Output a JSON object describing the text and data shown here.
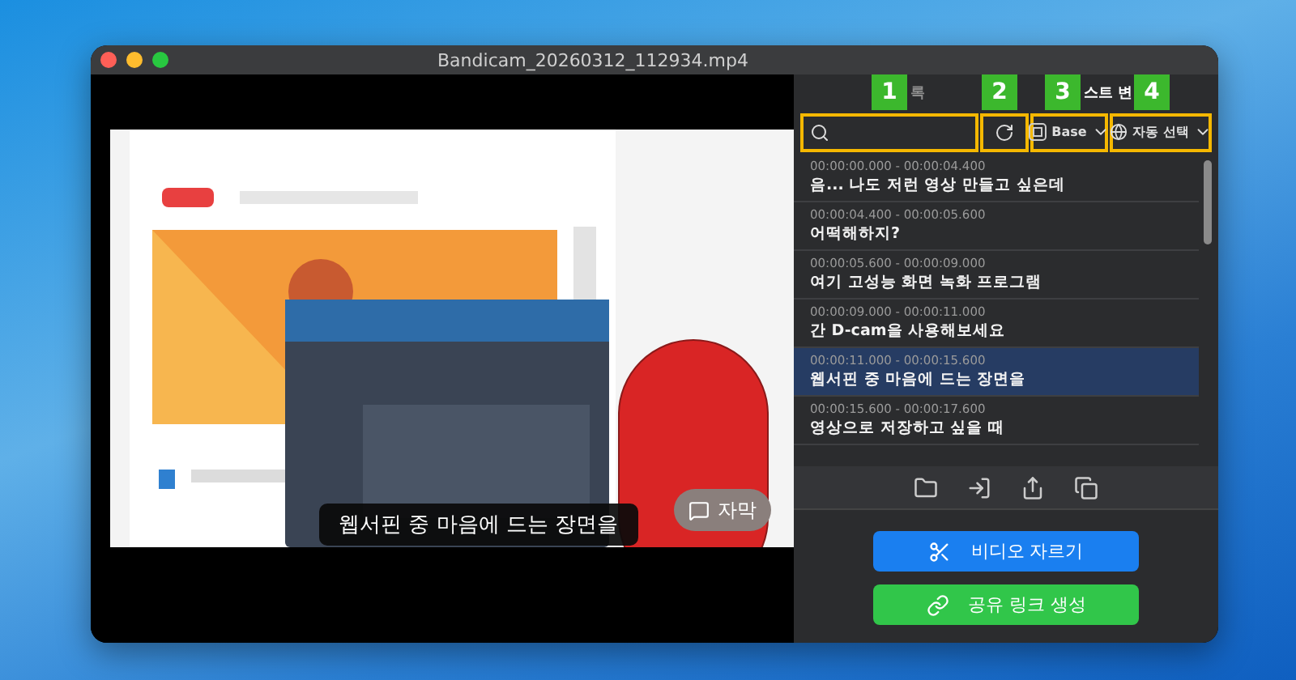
{
  "window": {
    "title": "Bandicam_20260312_112934.mp4"
  },
  "player": {
    "caption": "웹서핀 중 마음에 드는 장면을",
    "subtitle_button": "자막"
  },
  "tabs": [
    {
      "label": "록",
      "selected": false
    },
    {
      "label": "스트 변",
      "selected": true
    }
  ],
  "toolbar": {
    "search": {
      "badge": "1",
      "highlighted": true
    },
    "refresh": {
      "badge": "2",
      "highlighted": true
    },
    "model": {
      "label": "Base",
      "badge": "3",
      "highlighted": true
    },
    "language": {
      "label": "자동 선택",
      "badge": "4",
      "highlighted": true
    }
  },
  "subtitles": [
    {
      "time": "00:00:00.000 - 00:00:04.400",
      "text": "음... 나도 저런 영상 만들고 싶은데",
      "selected": false
    },
    {
      "time": "00:00:04.400 - 00:00:05.600",
      "text": "어떡해하지?",
      "selected": false
    },
    {
      "time": "00:00:05.600 - 00:00:09.000",
      "text": "여기 고성능 화면 녹화 프로그램",
      "selected": false
    },
    {
      "time": "00:00:09.000 - 00:00:11.000",
      "text": "간 D-cam을 사용해보세요",
      "selected": false
    },
    {
      "time": "00:00:11.000 - 00:00:15.600",
      "text": "웹서핀 중 마음에 드는 장면을",
      "selected": true
    },
    {
      "time": "00:00:15.600 - 00:00:17.600",
      "text": "영상으로 저장하고 싶을 때",
      "selected": false
    }
  ],
  "buttons": [
    {
      "kind": "cut",
      "label": "비디오 자르기"
    },
    {
      "kind": "share",
      "label": "공유 링크 생성"
    }
  ]
}
